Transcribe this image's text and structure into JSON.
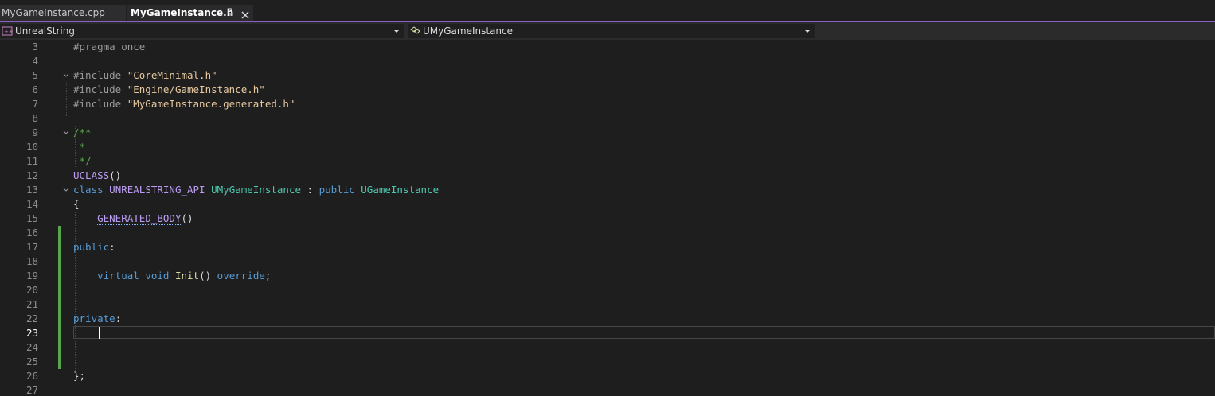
{
  "tabs": [
    {
      "label": "MyGameInstance.cpp",
      "active": false
    },
    {
      "label": "MyGameInstance.h",
      "active": true
    }
  ],
  "nav": {
    "project": "UnrealString",
    "scope": "UMyGameInstance"
  },
  "editor": {
    "current_line": "23",
    "line_numbers": [
      "3",
      "4",
      "5",
      "6",
      "7",
      "8",
      "9",
      "10",
      "11",
      "12",
      "13",
      "14",
      "15",
      "16",
      "17",
      "18",
      "19",
      "20",
      "21",
      "22",
      "23",
      "24",
      "25",
      "26",
      "27"
    ],
    "code": {
      "l3": "#pragma once",
      "l5_pp": "#include ",
      "l5_str": "\"CoreMinimal.h\"",
      "l6_pp": "#include ",
      "l6_str": "\"Engine/GameInstance.h\"",
      "l7_pp": "#include ",
      "l7_str": "\"MyGameInstance.generated.h\"",
      "l9": "/**",
      "l10": " *",
      "l11": " */",
      "l12_macro": "UCLASS",
      "l12_rest": "()",
      "l13_kw": "class",
      "l13_api": "UNREALSTRING_API",
      "l13_cls": "UMyGameInstance",
      "l13_colon": " : ",
      "l13_pub": "public",
      "l13_base": "UGameInstance",
      "l14": "{",
      "l15_macro": "GENERATED_BODY",
      "l15_rest": "()",
      "l17_kw": "public",
      "l17_rest": ":",
      "l19_virtual": "virtual",
      "l19_void": "void",
      "l19_fn": "Init",
      "l19_paren": "()",
      "l19_override": "override",
      "l19_semi": ";",
      "l22_kw": "private",
      "l22_rest": ":",
      "l26": "};"
    }
  },
  "colors": {
    "accent": "#8a5fc6",
    "change_bar": "#57a64a",
    "keyword": "#569cd6",
    "type": "#4ec9b0",
    "string": "#e8c9a0",
    "comment": "#57a64a",
    "macro": "#bd9df4",
    "function": "#dcdcaa"
  },
  "icons": {
    "pin": "pin-icon",
    "close": "close-icon",
    "project": "cpp-project-icon",
    "scope": "class-scope-icon",
    "dropdown": "chevron-down-icon",
    "fold": "fold-chevron-icon"
  }
}
